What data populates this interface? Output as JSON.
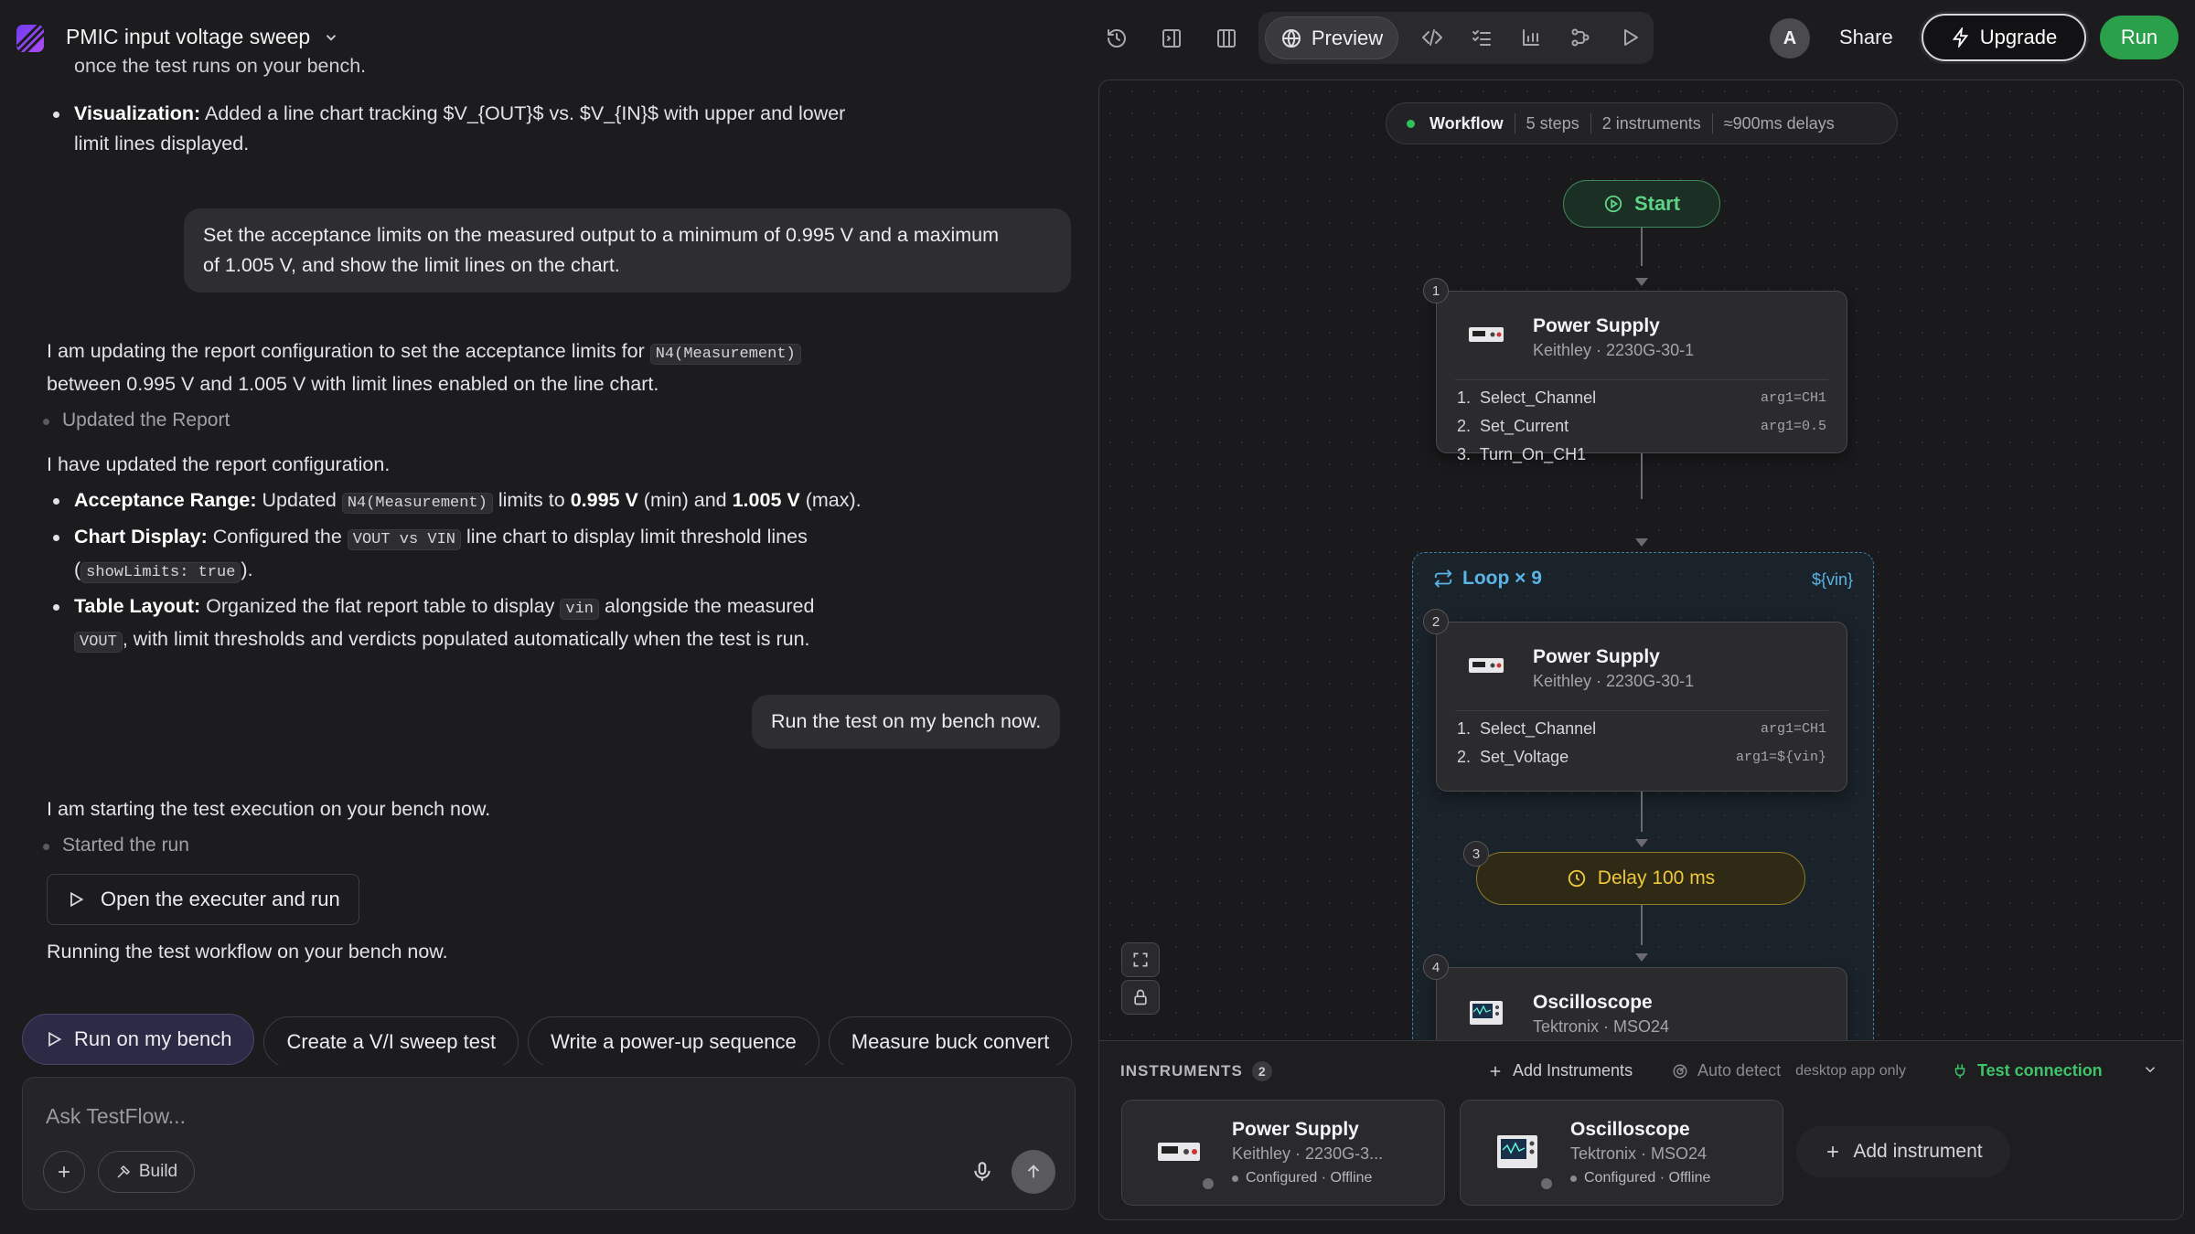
{
  "header": {
    "project_title": "PMIC input voltage sweep",
    "preview_label": "Preview",
    "avatar_initial": "A",
    "share_label": "Share",
    "upgrade_label": "Upgrade",
    "run_label": "Run",
    "accent_color": "#2aa04a"
  },
  "chat": {
    "top_partial": "once the test runs on your bench.",
    "viz_bold": "Visualization:",
    "viz_text1": "Added a line chart tracking $V_{OUT}$ vs. $V_{IN}$ with upper and lower",
    "viz_text2": "limit lines displayed.",
    "user_msg_1_line1": "Set the acceptance limits on the measured output to a minimum of 0.995 V and a maximum",
    "user_msg_1_line2": "of 1.005 V, and show the limit lines on the chart.",
    "reply1_a": "I am updating the report configuration to set the acceptance limits for",
    "reply1_code": "N4(Measurement)",
    "reply1_b": "between 0.995 V and 1.005 V with limit lines enabled on the line chart.",
    "step_updated": "Updated the Report",
    "reply2": "I have updated the report configuration.",
    "b1_bold": "Acceptance Range:",
    "b1_t1": "Updated",
    "b1_code": "N4(Measurement)",
    "b1_t2": "limits to",
    "b1_min": "0.995 V",
    "b1_t3": "(min) and",
    "b1_max": "1.005 V",
    "b1_t4": "(max).",
    "b2_bold": "Chart Display:",
    "b2_t1": "Configured the",
    "b2_code": "VOUT vs VIN",
    "b2_t2": "line chart to display limit threshold lines",
    "b2_t3": "(",
    "b2_code2": "showLimits: true",
    "b2_t4": ").",
    "b3_bold": "Table Layout:",
    "b3_t1": "Organized the flat report table to display",
    "b3_code": "vin",
    "b3_t2": "alongside the measured",
    "b3_code2": "VOUT",
    "b3_t3": ", with limit thresholds and verdicts populated automatically when the test is run.",
    "user_msg_2": "Run the test on my bench now.",
    "reply3": "I am starting the test execution on your bench now.",
    "step_started": "Started the run",
    "open_exec": "Open the executer and run",
    "reply4": "Running the test workflow on your bench now."
  },
  "suggestions": [
    "Run on my bench",
    "Create a V/I sweep test",
    "Write a power-up sequence",
    "Measure buck convert"
  ],
  "composer": {
    "placeholder": "Ask TestFlow...",
    "build_label": "Build"
  },
  "workflow": {
    "pill_label": "Workflow",
    "steps": "5 steps",
    "instruments": "2 instruments",
    "delays": "≈900ms delays",
    "start_label": "Start",
    "node1": {
      "num": "1",
      "title": "Power Supply",
      "subtitle": "Keithley · 2230G-30-1",
      "rows": [
        {
          "idx": "1.",
          "name": "Select_Channel",
          "arg": "arg1=CH1"
        },
        {
          "idx": "2.",
          "name": "Set_Current",
          "arg": "arg1=0.5"
        },
        {
          "idx": "3.",
          "name": "Turn_On_CH1",
          "arg": ""
        }
      ]
    },
    "loop": {
      "label": "Loop × 9",
      "var": "${vin}"
    },
    "node2": {
      "num": "2",
      "title": "Power Supply",
      "subtitle": "Keithley · 2230G-30-1",
      "rows": [
        {
          "idx": "1.",
          "name": "Select_Channel",
          "arg": "arg1=CH1"
        },
        {
          "idx": "2.",
          "name": "Set_Voltage",
          "arg": "arg1=${vin}"
        }
      ]
    },
    "node3": {
      "num": "3",
      "label": "Delay 100 ms"
    },
    "node4": {
      "num": "4",
      "title": "Oscilloscope",
      "subtitle": "Tektronix · MSO24"
    }
  },
  "instruments": {
    "header": "INSTRUMENTS",
    "count": "2",
    "add_label": "Add Instruments",
    "auto_detect": "Auto detect",
    "desktop_only": "desktop app only",
    "test_connection": "Test connection",
    "cards": [
      {
        "title": "Power Supply",
        "subtitle": "Keithley · 2230G-3...",
        "status": "Configured · Offline"
      },
      {
        "title": "Oscilloscope",
        "subtitle": "Tektronix · MSO24",
        "status": "Configured · Offline"
      }
    ],
    "add_instrument": "Add instrument"
  }
}
